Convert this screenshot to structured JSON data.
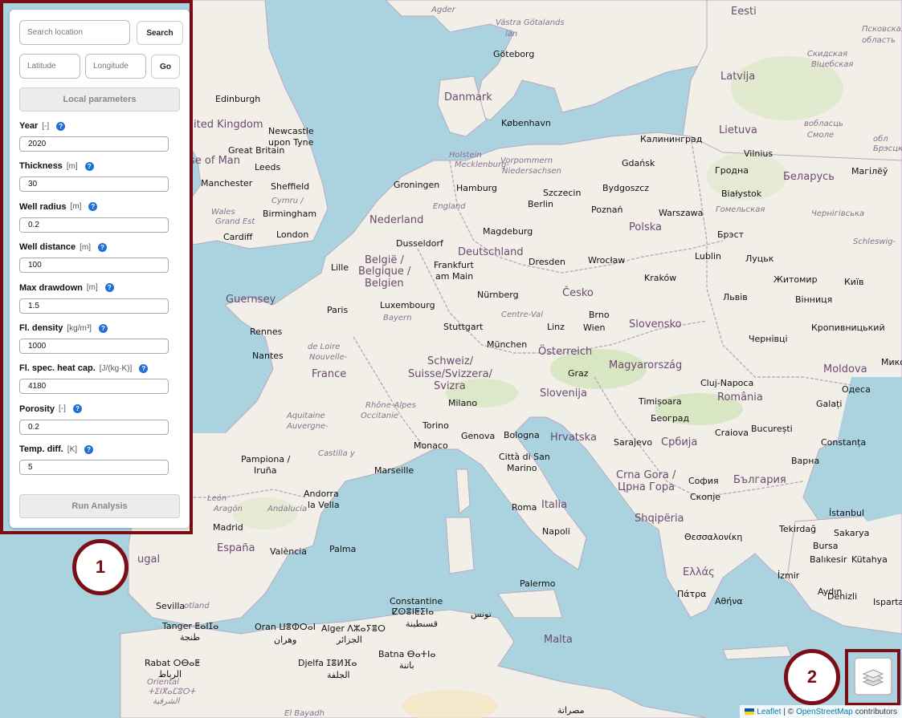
{
  "panel": {
    "search_placeholder": "Search location",
    "search_label": "Search",
    "lat_placeholder": "Latitude",
    "lon_placeholder": "Longitude",
    "go_label": "Go",
    "local_params_label": "Local parameters",
    "run_label": "Run Analysis",
    "help_symbol": "?",
    "params": [
      {
        "label": "Year",
        "unit": "[-]",
        "value": "2020"
      },
      {
        "label": "Thickness",
        "unit": "[m]",
        "value": "30"
      },
      {
        "label": "Well radius",
        "unit": "[m]",
        "value": "0.2"
      },
      {
        "label": "Well distance",
        "unit": "[m]",
        "value": "100"
      },
      {
        "label": "Max drawdown",
        "unit": "[m]",
        "value": "1.5"
      },
      {
        "label": "Fl. density",
        "unit": "[kg/m³]",
        "value": "1000"
      },
      {
        "label": "Fl. spec. heat cap.",
        "unit": "[J/(kg·K)]",
        "value": "4180"
      },
      {
        "label": "Porosity",
        "unit": "[-]",
        "value": "0.2"
      },
      {
        "label": "Temp. diff.",
        "unit": "[K]",
        "value": "5"
      }
    ]
  },
  "badges": {
    "one": "1",
    "two": "2"
  },
  "attribution": {
    "leaflet": "Leaflet",
    "sep": "| ©",
    "osm": "OpenStreetMap",
    "contributors": "contributors"
  },
  "map": {
    "labels": [
      {
        "text": "Eesti",
        "cls": "country"
      },
      {
        "text": "Latvija",
        "cls": "country"
      },
      {
        "text": "Lietuva",
        "cls": "country"
      },
      {
        "text": "Danmark",
        "cls": "country"
      },
      {
        "text": "Nederland",
        "cls": "country"
      },
      {
        "text": "Deutschland",
        "cls": "country"
      },
      {
        "text": "Polska",
        "cls": "country"
      },
      {
        "text": "Беларусь",
        "cls": "country"
      },
      {
        "text": "Česko",
        "cls": "country"
      },
      {
        "text": "Slovensko",
        "cls": "country"
      },
      {
        "text": "Österreich",
        "cls": "country"
      },
      {
        "text": "Magyarország",
        "cls": "country"
      },
      {
        "text": "France",
        "cls": "country"
      },
      {
        "text": "Schweiz/",
        "cls": "country"
      },
      {
        "text": "Suisse/Svizzera/",
        "cls": "country"
      },
      {
        "text": "Svizra",
        "cls": "country"
      },
      {
        "text": "Slovenija",
        "cls": "country"
      },
      {
        "text": "Hrvatska",
        "cls": "country"
      },
      {
        "text": "România",
        "cls": "country"
      },
      {
        "text": "Moldova",
        "cls": "country"
      },
      {
        "text": "Србија",
        "cls": "country"
      },
      {
        "text": "Crna Gora /",
        "cls": "country"
      },
      {
        "text": "Црна Гора",
        "cls": "country"
      },
      {
        "text": "България",
        "cls": "country"
      },
      {
        "text": "Shqipëria",
        "cls": "country"
      },
      {
        "text": "Italia",
        "cls": "country"
      },
      {
        "text": "España",
        "cls": "country"
      },
      {
        "text": "Ελλάς",
        "cls": "country"
      },
      {
        "text": "Malta",
        "cls": "country"
      },
      {
        "text": "België /",
        "cls": "country"
      },
      {
        "text": "Belgique /",
        "cls": "country"
      },
      {
        "text": "Belgien",
        "cls": "country"
      },
      {
        "text": "Guernsey",
        "cls": "country"
      },
      {
        "text": "ited Kingdom",
        "cls": "country"
      },
      {
        "text": "se of Man",
        "cls": "country"
      },
      {
        "text": "ugal",
        "cls": "country"
      },
      {
        "text": "Edinburgh",
        "cls": "city"
      },
      {
        "text": "Newcastle",
        "cls": "city"
      },
      {
        "text": "upon Tyne",
        "cls": "city"
      },
      {
        "text": "Great Britain",
        "cls": "city"
      },
      {
        "text": "Leeds",
        "cls": "city"
      },
      {
        "text": "Manchester",
        "cls": "city"
      },
      {
        "text": "Sheffield",
        "cls": "city"
      },
      {
        "text": "Birmingham",
        "cls": "city"
      },
      {
        "text": "Cardiff",
        "cls": "city"
      },
      {
        "text": "London",
        "cls": "city"
      },
      {
        "text": "Lille",
        "cls": "city"
      },
      {
        "text": "Paris",
        "cls": "city"
      },
      {
        "text": "Rennes",
        "cls": "city"
      },
      {
        "text": "Nantes",
        "cls": "city"
      },
      {
        "text": "Göteborg",
        "cls": "city"
      },
      {
        "text": "København",
        "cls": "city"
      },
      {
        "text": "Hamburg",
        "cls": "city"
      },
      {
        "text": "Groningen",
        "cls": "city"
      },
      {
        "text": "Berlin",
        "cls": "city"
      },
      {
        "text": "Szczecin",
        "cls": "city"
      },
      {
        "text": "Bydgoszcz",
        "cls": "city"
      },
      {
        "text": "Gdańsk",
        "cls": "city"
      },
      {
        "text": "Калининград",
        "cls": "city"
      },
      {
        "text": "Vilnius",
        "cls": "city"
      },
      {
        "text": "Гродна",
        "cls": "city"
      },
      {
        "text": "Białystok",
        "cls": "city"
      },
      {
        "text": "Magdeburg",
        "cls": "city"
      },
      {
        "text": "Poznań",
        "cls": "city"
      },
      {
        "text": "Warszawa",
        "cls": "city"
      },
      {
        "text": "Dusseldorf",
        "cls": "city"
      },
      {
        "text": "Frankfurt",
        "cls": "city"
      },
      {
        "text": "am Main",
        "cls": "city"
      },
      {
        "text": "Dresden",
        "cls": "city"
      },
      {
        "text": "Wrocław",
        "cls": "city"
      },
      {
        "text": "Lublin",
        "cls": "city"
      },
      {
        "text": "Kraków",
        "cls": "city"
      },
      {
        "text": "Luxembourg",
        "cls": "city"
      },
      {
        "text": "Nürnberg",
        "cls": "city"
      },
      {
        "text": "Stuttgart",
        "cls": "city"
      },
      {
        "text": "München",
        "cls": "city"
      },
      {
        "text": "Linz",
        "cls": "city"
      },
      {
        "text": "Brno",
        "cls": "city"
      },
      {
        "text": "Wien",
        "cls": "city"
      },
      {
        "text": "Graz",
        "cls": "city"
      },
      {
        "text": "Milano",
        "cls": "city"
      },
      {
        "text": "Torino",
        "cls": "city"
      },
      {
        "text": "Monaco",
        "cls": "city"
      },
      {
        "text": "Genova",
        "cls": "city"
      },
      {
        "text": "Bologna",
        "cls": "city"
      },
      {
        "text": "Marseille",
        "cls": "city"
      },
      {
        "text": "Città di San",
        "cls": "city"
      },
      {
        "text": "Marino",
        "cls": "city"
      },
      {
        "text": "Roma",
        "cls": "city"
      },
      {
        "text": "Napoli",
        "cls": "city"
      },
      {
        "text": "Palermo",
        "cls": "city"
      },
      {
        "text": "Sarajevo",
        "cls": "city"
      },
      {
        "text": "Београд",
        "cls": "city"
      },
      {
        "text": "Timișoara",
        "cls": "city"
      },
      {
        "text": "Cluj-Napoca",
        "cls": "city"
      },
      {
        "text": "Craiova",
        "cls": "city"
      },
      {
        "text": "București",
        "cls": "city"
      },
      {
        "text": "Constanța",
        "cls": "city"
      },
      {
        "text": "Galați",
        "cls": "city"
      },
      {
        "text": "Одеса",
        "cls": "city"
      },
      {
        "text": "Миколаї",
        "cls": "city"
      },
      {
        "text": "Кропивницький",
        "cls": "city"
      },
      {
        "text": "Вінниця",
        "cls": "city"
      },
      {
        "text": "Житомир",
        "cls": "city"
      },
      {
        "text": "Київ",
        "cls": "city"
      },
      {
        "text": "Львів",
        "cls": "city"
      },
      {
        "text": "Чернівці",
        "cls": "city"
      },
      {
        "text": "Луцьк",
        "cls": "city"
      },
      {
        "text": "Брэст",
        "cls": "city"
      },
      {
        "text": "Мaгілёў",
        "cls": "city"
      },
      {
        "text": "Варна",
        "cls": "city"
      },
      {
        "text": "София",
        "cls": "city"
      },
      {
        "text": "Скопје",
        "cls": "city"
      },
      {
        "text": "Θεσσαλονίκη",
        "cls": "city"
      },
      {
        "text": "Tekirdağ",
        "cls": "city"
      },
      {
        "text": "İstanbul",
        "cls": "city"
      },
      {
        "text": "Sakarya",
        "cls": "city"
      },
      {
        "text": "Bursa",
        "cls": "city"
      },
      {
        "text": "Balıkesir",
        "cls": "city"
      },
      {
        "text": "Kütahya",
        "cls": "city"
      },
      {
        "text": "İzmir",
        "cls": "city"
      },
      {
        "text": "Aydın",
        "cls": "city"
      },
      {
        "text": "Denizli",
        "cls": "city"
      },
      {
        "text": "Isparta",
        "cls": "city"
      },
      {
        "text": "Αθήνα",
        "cls": "city"
      },
      {
        "text": "Πάτρα",
        "cls": "city"
      },
      {
        "text": "Pampiona /",
        "cls": "city"
      },
      {
        "text": "Iruña",
        "cls": "city"
      },
      {
        "text": "Andorra",
        "cls": "city"
      },
      {
        "text": "la Vella",
        "cls": "city"
      },
      {
        "text": "Madrid",
        "cls": "city"
      },
      {
        "text": "València",
        "cls": "city"
      },
      {
        "text": "Palma",
        "cls": "city"
      },
      {
        "text": "Sevilla",
        "cls": "city"
      },
      {
        "text": "Tanger ⵟⴰⵏⵊⴰ",
        "cls": "city"
      },
      {
        "text": "طنجة",
        "cls": "city"
      },
      {
        "text": "Oran ⵡⴻⵀⵔⴰⵏ",
        "cls": "city"
      },
      {
        "text": "وهران",
        "cls": "city"
      },
      {
        "text": "Alger ⴷⵣⴰⵢⴻⵔ",
        "cls": "city"
      },
      {
        "text": "الجزائر",
        "cls": "city"
      },
      {
        "text": "Constantine",
        "cls": "city"
      },
      {
        "text": "ⵇⵙⴻⵏⵟⵉⵏⴰ",
        "cls": "city"
      },
      {
        "text": "قسنطينة",
        "cls": "city"
      },
      {
        "text": "تونس",
        "cls": "city"
      },
      {
        "text": "Batna ⴱⴰⵜⵏⴰ",
        "cls": "city"
      },
      {
        "text": "باتنة",
        "cls": "city"
      },
      {
        "text": "Djelfa ⵊⴻⵍⴼⴰ",
        "cls": "city"
      },
      {
        "text": "الجلفة",
        "cls": "city"
      },
      {
        "text": "Rabat ⵔⴱⴰⵟ",
        "cls": "city"
      },
      {
        "text": "الرباط",
        "cls": "city"
      },
      {
        "text": "El Bayadh",
        "cls": "region"
      },
      {
        "text": "Oriental",
        "cls": "region"
      },
      {
        "text": "ⵜⵉⵏⴳⴰⵎⵓⵔⵜ",
        "cls": "region"
      },
      {
        "text": "الشرقية",
        "cls": "region"
      },
      {
        "text": "مصراتة",
        "cls": "city"
      },
      {
        "text": "Agder",
        "cls": "region"
      },
      {
        "text": "Västra Götalands",
        "cls": "region"
      },
      {
        "text": "län",
        "cls": "region"
      },
      {
        "text": "Псковская",
        "cls": "region"
      },
      {
        "text": "область",
        "cls": "region"
      },
      {
        "text": "Скидская",
        "cls": "region"
      },
      {
        "text": "Віцебская",
        "cls": "region"
      },
      {
        "text": "вобласць",
        "cls": "region"
      },
      {
        "text": "Смоле",
        "cls": "region"
      },
      {
        "text": "обл",
        "cls": "region"
      },
      {
        "text": "Брэсцкая",
        "cls": "region"
      },
      {
        "text": "Гомельская",
        "cls": "region"
      },
      {
        "text": "Чернігівська",
        "cls": "region"
      },
      {
        "text": "Schleswig-",
        "cls": "region"
      },
      {
        "text": "Holstein",
        "cls": "region"
      },
      {
        "text": "Mecklenburg-",
        "cls": "region"
      },
      {
        "text": "Vorpommern",
        "cls": "region"
      },
      {
        "text": "Niedersachsen",
        "cls": "region"
      },
      {
        "text": "England",
        "cls": "region"
      },
      {
        "text": "Cymru /",
        "cls": "region"
      },
      {
        "text": "Wales",
        "cls": "region"
      },
      {
        "text": "Grand Est",
        "cls": "region"
      },
      {
        "text": "Bayern",
        "cls": "region"
      },
      {
        "text": "Centre-Val",
        "cls": "region"
      },
      {
        "text": "de Loire",
        "cls": "region"
      },
      {
        "text": "Nouvelle-",
        "cls": "region"
      },
      {
        "text": "Aquitaine",
        "cls": "region"
      },
      {
        "text": "Auvergne-",
        "cls": "region"
      },
      {
        "text": "Rhône-Alpes",
        "cls": "region"
      },
      {
        "text": "Occitanie",
        "cls": "region"
      },
      {
        "text": "Castilla y",
        "cls": "region"
      },
      {
        "text": "León",
        "cls": "region"
      },
      {
        "text": "Aragón",
        "cls": "region"
      },
      {
        "text": "Andalucía",
        "cls": "region"
      },
      {
        "text": "otland",
        "cls": "region"
      }
    ]
  }
}
